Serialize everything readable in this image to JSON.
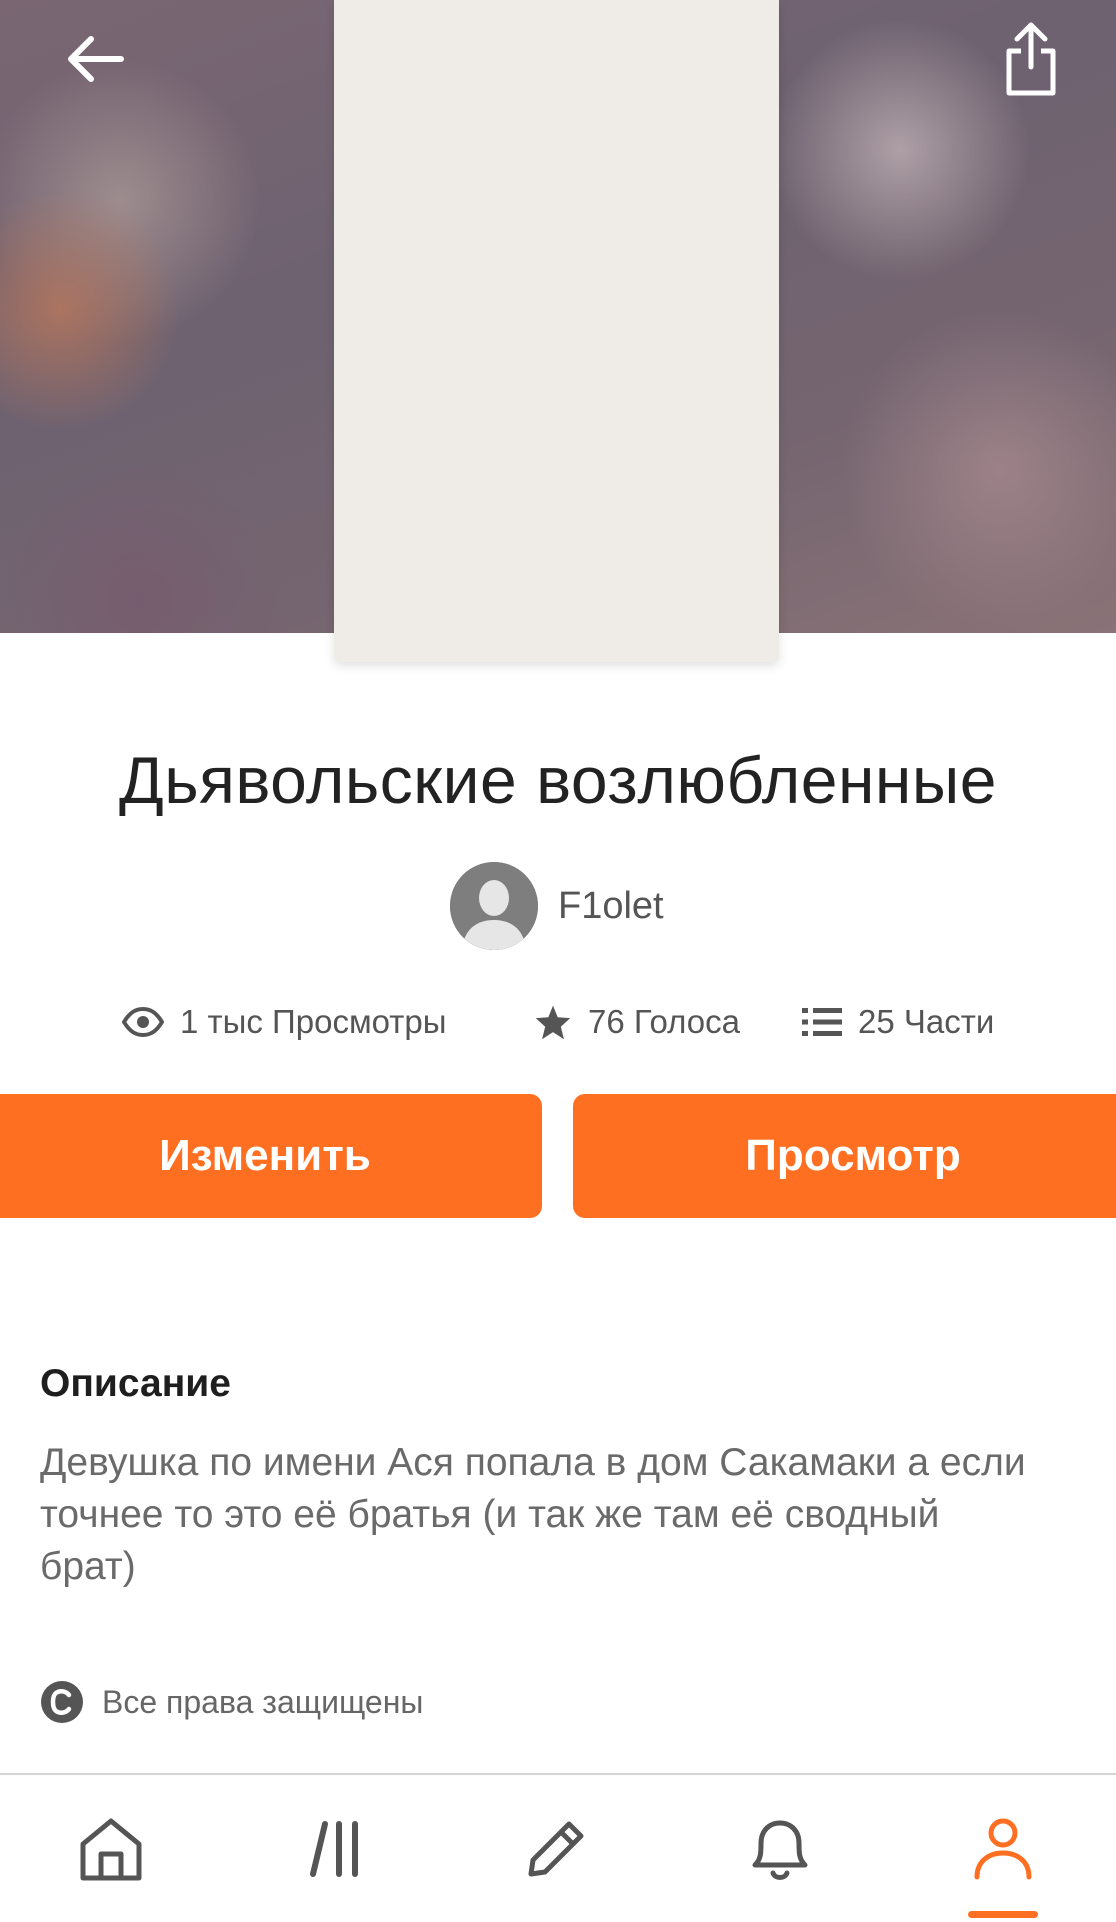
{
  "story": {
    "title": "Дьявольские возлюбленные",
    "author": "F1olet"
  },
  "stats": {
    "views": "1 тыс Просмотры",
    "votes": "76 Голоса",
    "parts": "25 Части"
  },
  "actions": {
    "edit_label": "Изменить",
    "view_label": "Просмотр"
  },
  "description": {
    "heading": "Описание",
    "text": "Девушка по имени Ася попала в дом Сакамаки а если точнее то это её братья (и так же там её сводный брат)"
  },
  "copyright": "Все права защищены",
  "nav": {
    "items": [
      "home-icon",
      "library-icon",
      "write-icon",
      "notifications-icon",
      "profile-icon"
    ],
    "active": "profile-icon"
  },
  "colors": {
    "accent": "#ff6f22",
    "cover_placeholder": "#efebe6"
  }
}
